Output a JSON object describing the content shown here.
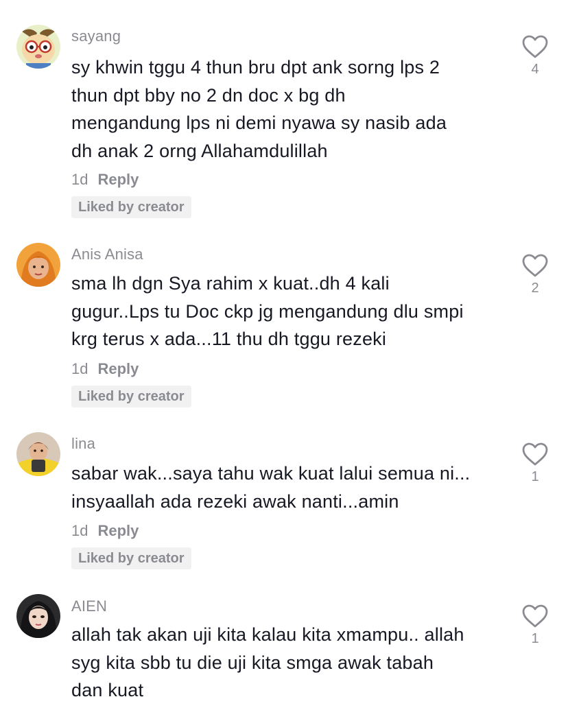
{
  "comments": [
    {
      "username": "sayang",
      "text_lines": [
        "sy khwin tggu 4 thun bru dpt ank sorng lps 2",
        "thun dpt bby no 2 dn doc x bg dh",
        "mengandung lps ni demi nyawa sy nasib ada",
        "dh anak 2 orng Allahamdulillah"
      ],
      "time": "1d",
      "reply_label": "Reply",
      "liked_badge": "Liked by creator",
      "likes": "4",
      "avatar_icon": "cartoon-avatar-icon",
      "colors": {
        "avatar_bg": "#e9efc9"
      }
    },
    {
      "username": "Anis Anisa",
      "text_lines": [
        "sma lh dgn Sya rahim x kuat..dh 4 kali",
        "gugur..Lps tu Doc ckp jg mengandung dlu smpi",
        "krg terus x ada...11 thu dh tggu rezeki"
      ],
      "time": "1d",
      "reply_label": "Reply",
      "liked_badge": "Liked by creator",
      "likes": "2",
      "avatar_icon": "user-photo-icon",
      "colors": {
        "avatar_bg": "#f2a23a"
      }
    },
    {
      "username": "lina",
      "text_lines": [
        "sabar wak...saya tahu wak kuat lalui semua ni...",
        "insyaallah ada rezeki awak nanti...amin"
      ],
      "time": "1d",
      "reply_label": "Reply",
      "liked_badge": "Liked by creator",
      "likes": "1",
      "avatar_icon": "user-photo-icon",
      "colors": {
        "avatar_bg": "#d8c8b8"
      }
    },
    {
      "username": "AIEN",
      "text_lines": [
        "allah tak akan uji kita kalau kita xmampu.. allah",
        "syg kita sbb tu die uji kita smga awak tabah",
        "dan kuat"
      ],
      "likes": "1",
      "avatar_icon": "user-photo-icon",
      "colors": {
        "avatar_bg": "#2b2b2e"
      }
    }
  ],
  "colors": {
    "text": "#161823",
    "secondary": "#8a8b91",
    "badge_bg": "#f1f1f2"
  },
  "icons": {
    "like": "heart-outline-icon"
  }
}
